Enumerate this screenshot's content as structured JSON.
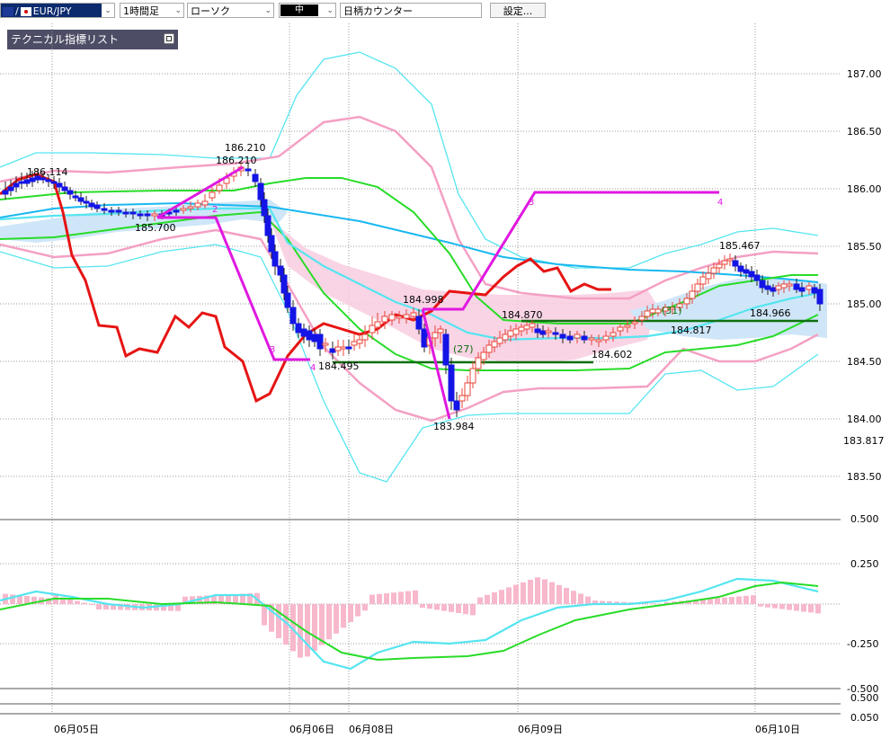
{
  "toolbar": {
    "symbol": "EUR/JPY",
    "timeframe": "1時間足",
    "chart_type": "ローソク",
    "color_label": "中",
    "counter_label": "日柄カウンター",
    "settings_label": "設定..."
  },
  "indicator_list": {
    "title": "テクニカル指標リスト"
  },
  "colors": {
    "bull": "#e8443a",
    "bear": "#1414e6",
    "ma_red": "#e61414",
    "ma_green": "#28dc28",
    "bb_pink": "#f4a0c4",
    "bb_cyan": "#55e5f0",
    "ma_blue": "#18b8f0",
    "zigzag": "#e018e0",
    "cloud": "#f8cce0",
    "cloud2": "#cfe6f8",
    "support": "#107010"
  },
  "price_axis": {
    "labels": [
      "187.00",
      "186.50",
      "186.00",
      "185.50",
      "185.00",
      "184.50",
      "184.00",
      "183.817",
      "183.50"
    ]
  },
  "date_axis": {
    "labels": [
      "06月05日",
      "06月06日",
      "06月08日",
      "06月09日",
      "06月10日"
    ]
  },
  "annotations": {
    "p1": "186.114",
    "p2": "186.210",
    "p3": "186.210",
    "p4": "185.700",
    "p5": "184.495",
    "p6": "184.998",
    "p7": "183.984",
    "p8": "184.870",
    "p9": "184.602",
    "p10": "185.467",
    "p11": "184.817",
    "p12": "184.966",
    "c1": "(27)",
    "c2": "(31)",
    "z1": "2",
    "z2": "3",
    "z3": "4",
    "z4": "3",
    "z5": "4"
  },
  "macd_axis": {
    "labels": [
      "0.250",
      "-0.250",
      "-0.500",
      "0.500",
      "0.500",
      "0.050"
    ]
  },
  "chart_data": {
    "type": "candlestick",
    "instrument": "EUR/JPY",
    "timeframe": "1時間足",
    "price_range": [
      183.5,
      187.0
    ],
    "marked_levels": [
      183.817
    ],
    "zigzag_points": [
      186.21,
      185.7,
      184.495,
      184.998,
      183.984,
      185.467
    ],
    "support_lines": [
      184.602,
      184.87
    ],
    "macd_range": [
      -0.5,
      0.5
    ]
  }
}
